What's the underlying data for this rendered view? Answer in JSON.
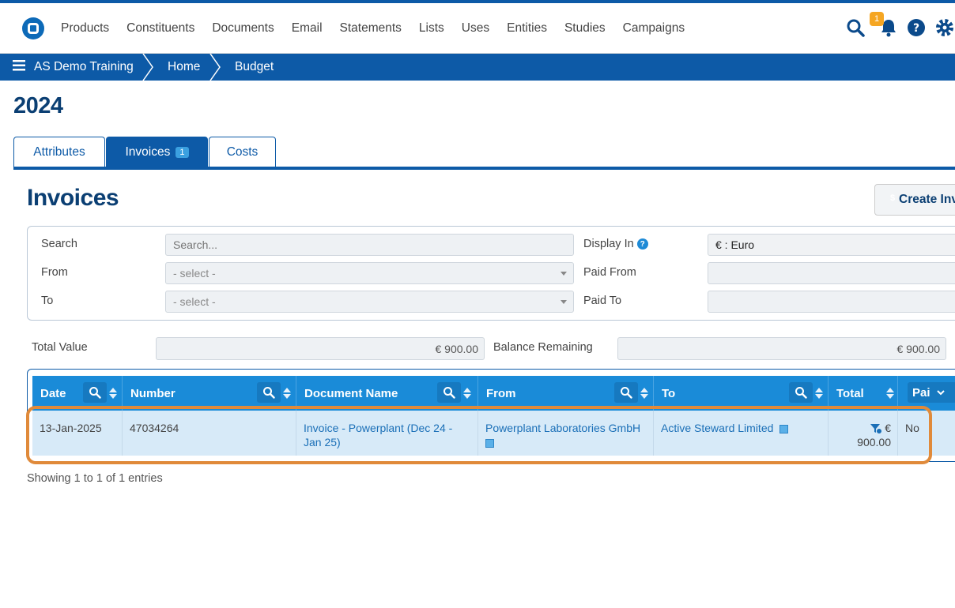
{
  "nav": {
    "items": [
      "Products",
      "Constituents",
      "Documents",
      "Email",
      "Statements",
      "Lists",
      "Uses",
      "Entities",
      "Studies",
      "Campaigns"
    ],
    "notification_count": "1"
  },
  "breadcrumb": {
    "items": [
      "AS Demo Training",
      "Home",
      "Budget"
    ]
  },
  "page": {
    "title": "2024"
  },
  "tabs": [
    {
      "label": "Attributes"
    },
    {
      "label": "Invoices",
      "badge": "1"
    },
    {
      "label": "Costs"
    }
  ],
  "invoices": {
    "title": "Invoices",
    "create_label": "Create Invoice",
    "filters": {
      "search_label": "Search",
      "search_placeholder": "Search...",
      "from_label": "From",
      "from_value": "- select -",
      "to_label": "To",
      "to_value": "- select -",
      "display_in_label": "Display In",
      "display_in_value": "€ : Euro",
      "paid_from_label": "Paid From",
      "paid_to_label": "Paid To"
    },
    "totals": {
      "total_value_label": "Total Value",
      "total_value": "€ 900.00",
      "balance_label": "Balance Remaining",
      "balance_value": "€ 900.00"
    },
    "table": {
      "columns": [
        "Date",
        "Number",
        "Document Name",
        "From",
        "To",
        "Total",
        "Pai"
      ],
      "rows": [
        {
          "date": "13-Jan-2025",
          "number": "47034264",
          "document_name": "Invoice - Powerplant (Dec 24 - Jan 25)",
          "from": "Powerplant Laboratories GmbH",
          "to": "Active Steward Limited",
          "total_currency": "€",
          "total_amount": "900.00",
          "paid": "No"
        }
      ]
    },
    "showing": "Showing 1 to 1 of 1 entries"
  }
}
